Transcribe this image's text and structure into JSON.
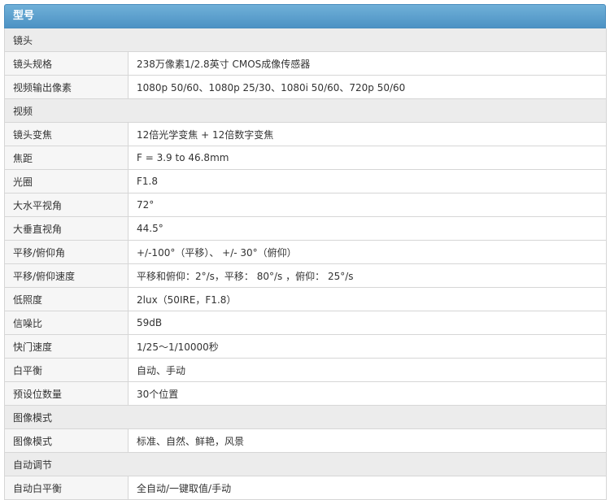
{
  "header": {
    "title": "型号"
  },
  "rows": [
    {
      "type": "section",
      "label": "镜头"
    },
    {
      "type": "item",
      "key": "镜头规格",
      "value": "238万像素1/2.8英寸 CMOS成像传感器"
    },
    {
      "type": "item",
      "key": "视频输出像素",
      "value": "1080p 50/60、1080p 25/30、1080i 50/60、720p 50/60"
    },
    {
      "type": "section",
      "label": "视频"
    },
    {
      "type": "item",
      "key": "镜头变焦",
      "value": "12倍光学变焦 + 12倍数字变焦"
    },
    {
      "type": "item",
      "key": "焦距",
      "value": "F = 3.9 to 46.8mm"
    },
    {
      "type": "item",
      "key": "光圈",
      "value": "F1.8"
    },
    {
      "type": "item",
      "key": "大水平视角",
      "value": "72°"
    },
    {
      "type": "item",
      "key": "大垂直视角",
      "value": "44.5°"
    },
    {
      "type": "item",
      "key": "平移/俯仰角",
      "value": "+/-100°（平移）、 +/- 30°（俯仰）"
    },
    {
      "type": "item",
      "key": "平移/俯仰速度",
      "value": "平移和俯仰：2°/s，平移： 80°/s ，俯仰： 25°/s"
    },
    {
      "type": "item",
      "key": "低照度",
      "value": "2lux（50IRE，F1.8）"
    },
    {
      "type": "item",
      "key": "信噪比",
      "value": "59dB"
    },
    {
      "type": "item",
      "key": "快门速度",
      "value": "1/25～1/10000秒"
    },
    {
      "type": "item",
      "key": "白平衡",
      "value": "自动、手动"
    },
    {
      "type": "item",
      "key": "预设位数量",
      "value": "30个位置"
    },
    {
      "type": "section",
      "label": "图像模式"
    },
    {
      "type": "item",
      "key": "图像模式",
      "value": "标准、自然、鲜艳，风景"
    },
    {
      "type": "section",
      "label": "自动调节"
    },
    {
      "type": "item",
      "key": "自动白平衡",
      "value": "全自动/一键取值/手动"
    }
  ]
}
